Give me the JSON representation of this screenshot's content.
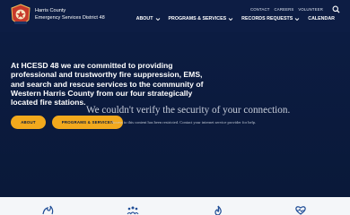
{
  "header": {
    "org_line1": "Harris County",
    "org_line2": "Emergency Services District 48",
    "utility_links": [
      "CONTACT",
      "CAREERS",
      "VOLUNTEER"
    ],
    "nav": [
      {
        "label": "ABOUT"
      },
      {
        "label": "PROGRAMS & SERVICES"
      },
      {
        "label": "RECORDS REQUESTS"
      },
      {
        "label": "CALENDAR"
      }
    ]
  },
  "hero": {
    "title": "At HCESD 48 we are committed to providing professional and trustworthy fire suppression, EMS, and search and rescue services to the community of Western Harris County from our four strategically located fire stations.",
    "buttons": {
      "about": "ABOUT",
      "programs": "PROGRAMS & SERVICES"
    }
  },
  "overlay": {
    "title": "We couldn't verify the security of your connection.",
    "text": "Access to this content has been restricted. Contact your internet service provider for help."
  },
  "colors": {
    "navy": "#0b1a3c",
    "accent": "#f2a91d",
    "icon_blue": "#1f4d96"
  },
  "icons": {
    "search": "search-icon",
    "features": [
      "fire-icon",
      "people-icon",
      "flame-icon",
      "heart-icon"
    ]
  }
}
